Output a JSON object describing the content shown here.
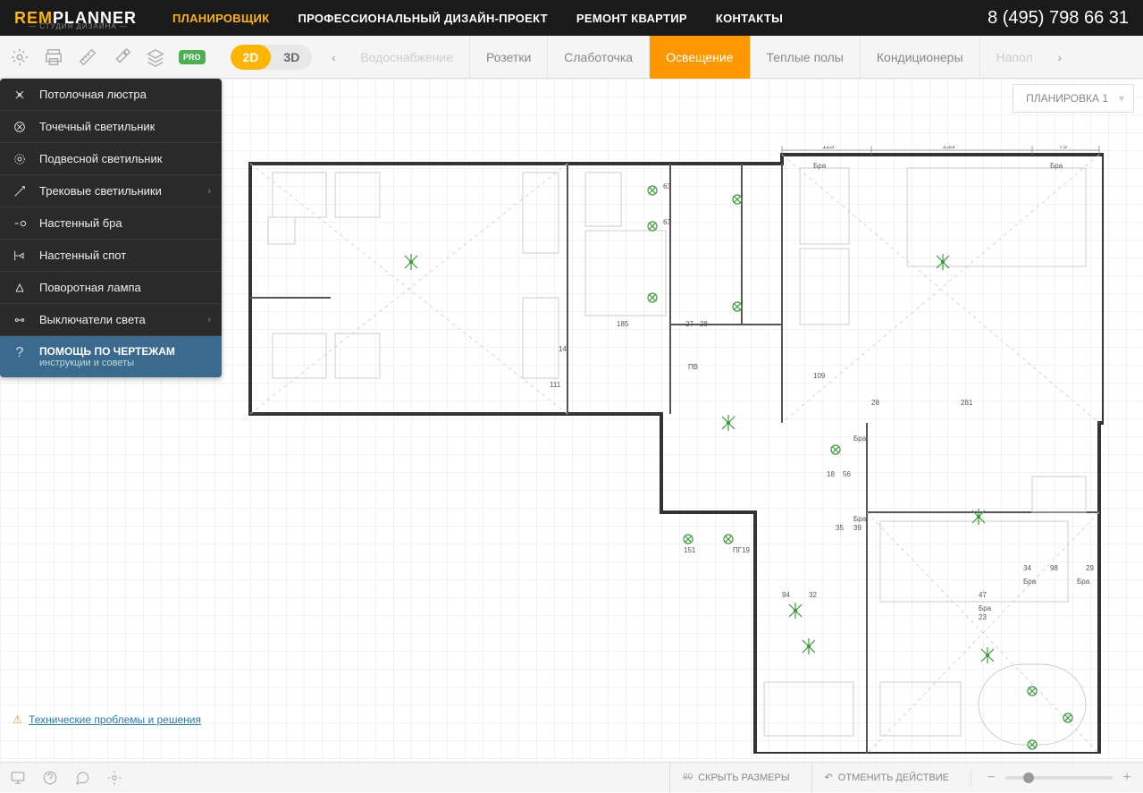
{
  "brand": {
    "rem": "REM",
    "planner": "PLANNER",
    "sub": "— СТУДИЯ ДИЗАЙНА —"
  },
  "topnav": {
    "items": [
      {
        "label": "ПЛАНИРОВЩИК",
        "active": true
      },
      {
        "label": "ПРОФЕССИОНАЛЬНЫЙ ДИЗАЙН-ПРОЕКТ",
        "active": false
      },
      {
        "label": "РЕМОНТ КВАРТИР",
        "active": false
      },
      {
        "label": "КОНТАКТЫ",
        "active": false
      }
    ]
  },
  "phone": "8 (495) 798 66 31",
  "toolbar": {
    "view2d": "2D",
    "view3d": "3D",
    "pro": "PRO"
  },
  "tabs": [
    {
      "label": "Водоснабжение",
      "state": "faded"
    },
    {
      "label": "Розетки",
      "state": ""
    },
    {
      "label": "Слаботочка",
      "state": ""
    },
    {
      "label": "Освещение",
      "state": "active"
    },
    {
      "label": "Теплые полы",
      "state": ""
    },
    {
      "label": "Кондиционеры",
      "state": ""
    },
    {
      "label": "Напол",
      "state": "faded"
    }
  ],
  "layout_selector": "ПЛАНИРОВКА 1",
  "sidebar": {
    "items": [
      {
        "label": "Потолочная люстра",
        "icon": "chandelier-icon",
        "hasSub": false
      },
      {
        "label": "Точечный светильник",
        "icon": "spot-icon",
        "hasSub": false
      },
      {
        "label": "Подвесной светильник",
        "icon": "pendant-icon",
        "hasSub": false
      },
      {
        "label": "Трековые светильники",
        "icon": "track-icon",
        "hasSub": true
      },
      {
        "label": "Настенный бра",
        "icon": "sconce-icon",
        "hasSub": false
      },
      {
        "label": "Настенный спот",
        "icon": "wallspot-icon",
        "hasSub": false
      },
      {
        "label": "Поворотная лампа",
        "icon": "rotlamp-icon",
        "hasSub": false
      },
      {
        "label": "Выключатели света",
        "icon": "switch-icon",
        "hasSub": true
      }
    ],
    "help_title": "ПОМОЩЬ ПО ЧЕРТЕЖАМ",
    "help_sub": "инструкции и советы"
  },
  "footer_link": "Технические проблемы и решения",
  "statusbar": {
    "hide_dims": "СКРЫТЬ РАЗМЕРЫ",
    "undo": "ОТМЕНИТЬ ДЕЙСТВИЕ"
  },
  "dimensions": {
    "top": [
      "125",
      "233",
      "75"
    ],
    "inner": [
      "63",
      "63",
      "185",
      "27",
      "28",
      "14",
      "111",
      "109",
      "28",
      "281",
      "18",
      "56",
      "35",
      "39",
      "151",
      "94",
      "32",
      "47",
      "34",
      "98",
      "29",
      "23"
    ],
    "labels": [
      "Бра",
      "Бра",
      "Бра",
      "Бра",
      "Бра",
      "Бра",
      "Бра",
      "ПВ",
      "ПГ19"
    ]
  }
}
